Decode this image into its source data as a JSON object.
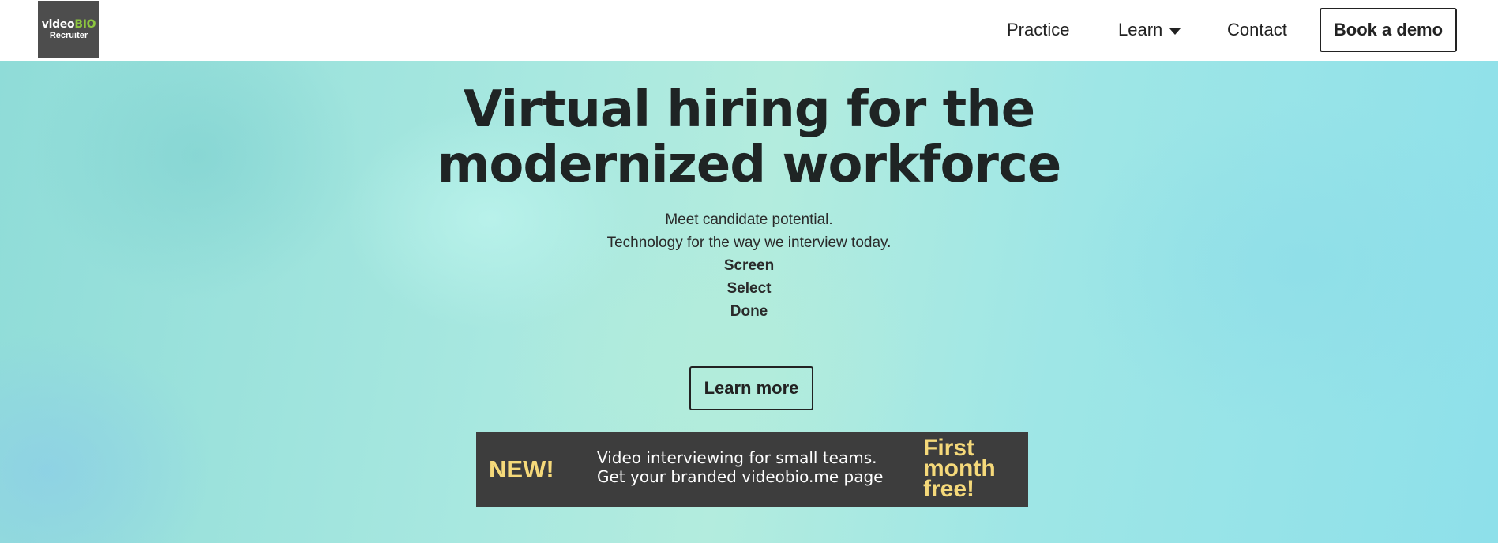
{
  "header": {
    "logo": {
      "brand_left": "video",
      "brand_right": "BIO",
      "sub": "Recruiter"
    },
    "nav": {
      "practice": "Practice",
      "learn": "Learn",
      "contact": "Contact",
      "book_demo": "Book a demo"
    }
  },
  "hero": {
    "headline_line1": "Virtual hiring for the",
    "headline_line2": "modernized workforce",
    "taglines": [
      "Meet candidate potential.",
      "Technology for the way we interview today.",
      "Screen",
      "Select",
      "Done"
    ],
    "learn_more": "Learn more"
  },
  "banner": {
    "new_label": "NEW!",
    "text_line1": "Video interviewing for small teams.",
    "text_line2": "Get your branded videobio.me page",
    "promo_line1": "First",
    "promo_line2": "month",
    "promo_line3": "free!"
  },
  "colors": {
    "logo_bg": "#4d4d4d",
    "logo_accent": "#8dc63f",
    "banner_bg": "#3d3d3d",
    "banner_accent": "#f5d97a",
    "hero_bg": "#a8e8e0"
  },
  "icons": {
    "learn_dropdown": "caret-down-icon"
  }
}
